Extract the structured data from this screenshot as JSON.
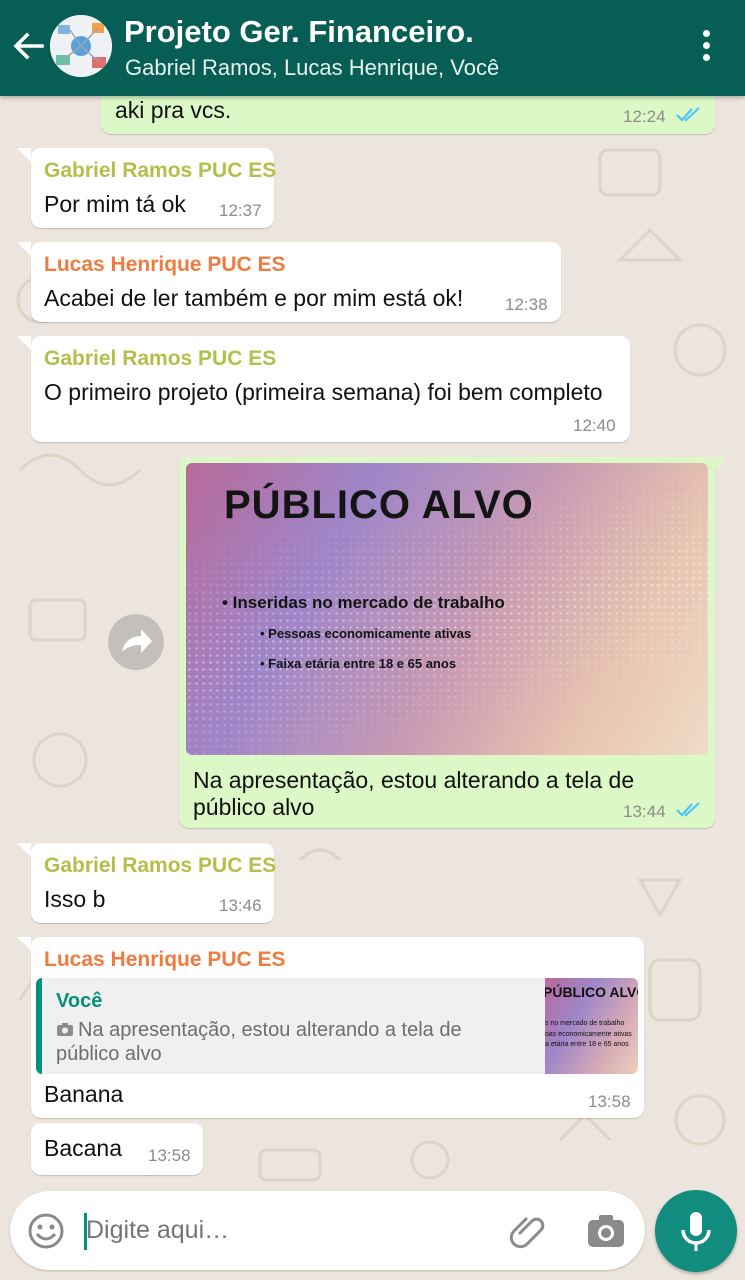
{
  "header": {
    "title": "Projeto Ger. Financeiro.",
    "subtitle": "Gabriel Ramos, Lucas Henrique, Você"
  },
  "messages": [
    {
      "text": "aki pra vcs.",
      "time": "12:24",
      "read": true
    },
    {
      "sender": "Gabriel Ramos PUC ES",
      "text": "Por mim tá ok",
      "time": "12:37"
    },
    {
      "sender": "Lucas Henrique PUC ES",
      "text": "Acabei de ler também  e por mim está  ok!",
      "time": "12:38"
    },
    {
      "sender": "Gabriel Ramos PUC ES",
      "text": "O primeiro projeto (primeira semana) foi bem completo",
      "time": "12:40"
    },
    {
      "image": {
        "title": "PÚBLICO ALVO",
        "bullet1": "• Inseridas no mercado de trabalho",
        "bullet2": "• Pessoas economicamente ativas",
        "bullet3": "• Faixa etária entre 18 e 65 anos"
      },
      "caption_line1": "Na apresentação, estou alterando a tela de",
      "caption_line2": "público alvo",
      "time": "13:44",
      "read": true
    },
    {
      "sender": "Gabriel Ramos PUC ES",
      "text": "Isso b",
      "time": "13:46"
    },
    {
      "sender": "Lucas Henrique PUC ES",
      "quote": {
        "author": "Você",
        "text": "Na apresentação, estou alterando a tela de público alvo",
        "thumb_title": "PÚBLICO ALVO",
        "thumb_line1": "s no mercado de trabalho",
        "thumb_line2": "oas economicamente ativas",
        "thumb_line3": "a etária entre 18 e 65 anos"
      },
      "text": "Banana",
      "time": "13:58"
    },
    {
      "text": "Bacana",
      "time": "13:58"
    }
  ],
  "input": {
    "placeholder": "Digite aqui…"
  },
  "colors": {
    "header": "#075e54",
    "outgoing_bubble": "#dcf8c6",
    "incoming_bubble": "#ffffff",
    "sender_gabriel": "#b3bf4a",
    "sender_lucas": "#f07b3f",
    "accent": "#128c7e",
    "read_ticks": "#4fc3f7"
  }
}
